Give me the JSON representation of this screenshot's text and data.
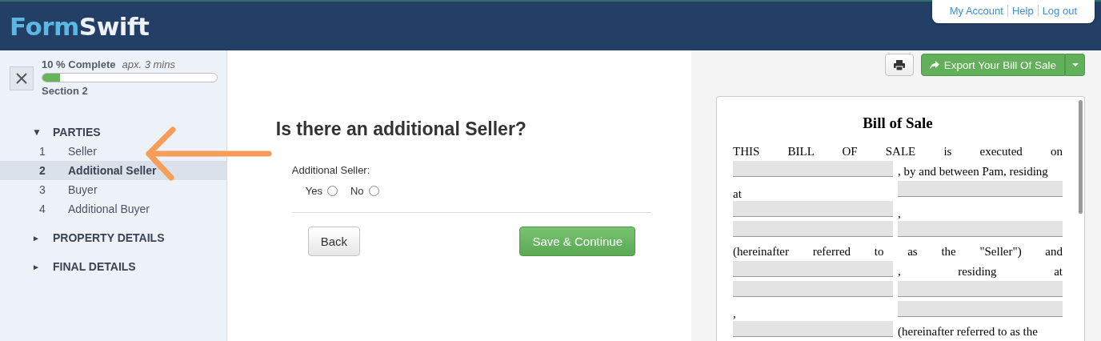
{
  "header": {
    "logo": [
      "Form",
      "Swift"
    ],
    "account_links": [
      "My Account",
      "Help",
      "Log out"
    ]
  },
  "sidebar": {
    "progress": {
      "label": "10 % Complete",
      "estimate": "apx. 3 mins",
      "level": 0.1,
      "section": "Section 2"
    },
    "sections": [
      {
        "title": "PARTIES",
        "marker": "▼",
        "expanded": true,
        "items": [
          {
            "number": "1",
            "label": "Seller",
            "selected": false
          },
          {
            "number": "2",
            "label": "Additional Seller",
            "selected": true
          },
          {
            "number": "3",
            "label": "Buyer",
            "selected": false
          },
          {
            "number": "4",
            "label": "Additional Buyer",
            "selected": false
          }
        ]
      },
      {
        "title": "PROPERTY DETAILS",
        "marker": "►",
        "expanded": false
      },
      {
        "title": "FINAL DETAILS",
        "marker": "►",
        "expanded": false
      }
    ]
  },
  "question": {
    "title": "Is there an additional Seller?",
    "field_label": "Additional Seller:",
    "options": [
      {
        "label": "Yes",
        "selected": false
      },
      {
        "label": "No",
        "selected": false
      }
    ],
    "buttons": {
      "back": "Back",
      "next": "Save & Continue"
    }
  },
  "preview": {
    "export_button": "Export Your Bill Of Sale",
    "document": {
      "title": "Bill of Sale",
      "lines": [
        [
          {
            "kind": "wide_text",
            "text": "THIS BILL OF SALE is executed on"
          }
        ],
        [
          {
            "kind": "blank"
          },
          {
            "kind": "text",
            "text": ", by and between Pam, residing"
          }
        ],
        [
          {
            "kind": "low_text",
            "text": "at"
          },
          {
            "kind": "blank"
          }
        ],
        [
          {
            "kind": "blank"
          },
          {
            "kind": "low_text",
            "text": ","
          }
        ],
        [
          {
            "kind": "blank"
          },
          {
            "kind": "blank"
          }
        ],
        [
          {
            "kind": "wide_text",
            "text": "(hereinafter referred to as the \"Seller\") and"
          }
        ],
        [
          {
            "kind": "blank"
          },
          {
            "kind": "spread_text",
            "text": ", residing at"
          }
        ],
        [
          {
            "kind": "blank"
          },
          {
            "kind": "blank"
          }
        ],
        [
          {
            "kind": "low_text",
            "text": ","
          },
          {
            "kind": "blank"
          }
        ],
        [
          {
            "kind": "blank"
          },
          {
            "kind": "text",
            "text": "(hereinafter referred to as the"
          }
        ]
      ]
    }
  },
  "annotation": {
    "kind": "arrow"
  }
}
